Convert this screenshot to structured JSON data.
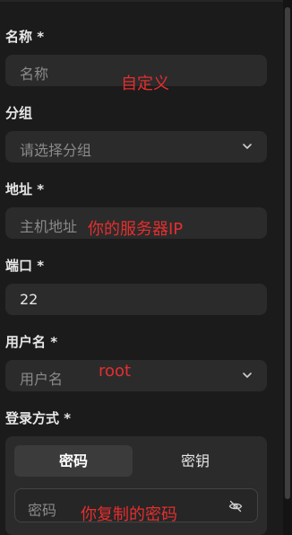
{
  "form": {
    "name": {
      "label": "名称 *",
      "placeholder": "名称"
    },
    "group": {
      "label": "分组",
      "placeholder": "请选择分组"
    },
    "address": {
      "label": "地址 *",
      "placeholder": "主机地址"
    },
    "port": {
      "label": "端口 *",
      "value": "22"
    },
    "username": {
      "label": "用户名 *",
      "placeholder": "用户名"
    },
    "login": {
      "label": "登录方式 *",
      "tabs": [
        "密码",
        "密钥"
      ],
      "active_tab": "密码",
      "password_placeholder": "密码"
    }
  },
  "annotations": {
    "name_note": "自定义",
    "address_note": "你的服务器IP",
    "username_note": "root",
    "password_note": "你复制的密码",
    "color": "#e52e2e"
  },
  "icons": {
    "select_arrow": "chevron-down-icon",
    "password_toggle": "eye-off-icon"
  },
  "colors": {
    "background": "#1b1b1b",
    "field": "#2b2b2b",
    "active_tab": "#3b3b3b"
  }
}
